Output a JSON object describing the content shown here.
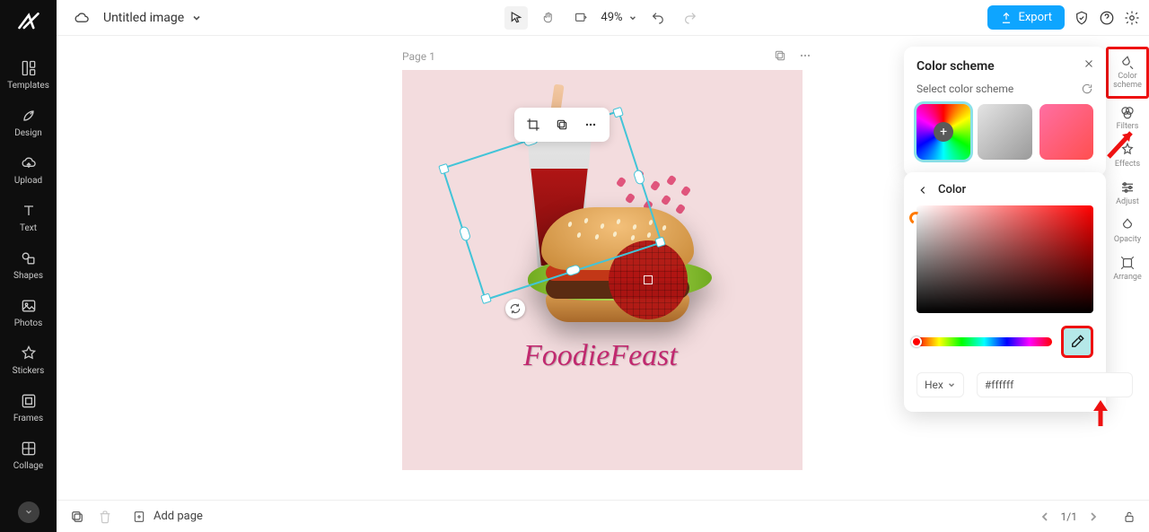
{
  "document": {
    "title": "Untitled image"
  },
  "toolbar": {
    "zoom": "49%",
    "export": "Export"
  },
  "leftnav": [
    {
      "label": "Templates"
    },
    {
      "label": "Design"
    },
    {
      "label": "Upload"
    },
    {
      "label": "Text"
    },
    {
      "label": "Shapes"
    },
    {
      "label": "Photos"
    },
    {
      "label": "Stickers"
    },
    {
      "label": "Frames"
    },
    {
      "label": "Collage"
    }
  ],
  "rtools": [
    {
      "label": "Color scheme"
    },
    {
      "label": "Filters"
    },
    {
      "label": "Effects"
    },
    {
      "label": "Adjust"
    },
    {
      "label": "Opacity"
    },
    {
      "label": "Arrange"
    }
  ],
  "panel": {
    "title": "Color scheme",
    "select_label": "Select color scheme",
    "color_hdr": "Color",
    "hex_label": "Hex",
    "hex_value": "#ffffff"
  },
  "canvas": {
    "page_label": "Page 1",
    "brand_text": "FoodieFeast"
  },
  "bottom": {
    "add_page": "Add page",
    "page_indicator": "1/1"
  }
}
